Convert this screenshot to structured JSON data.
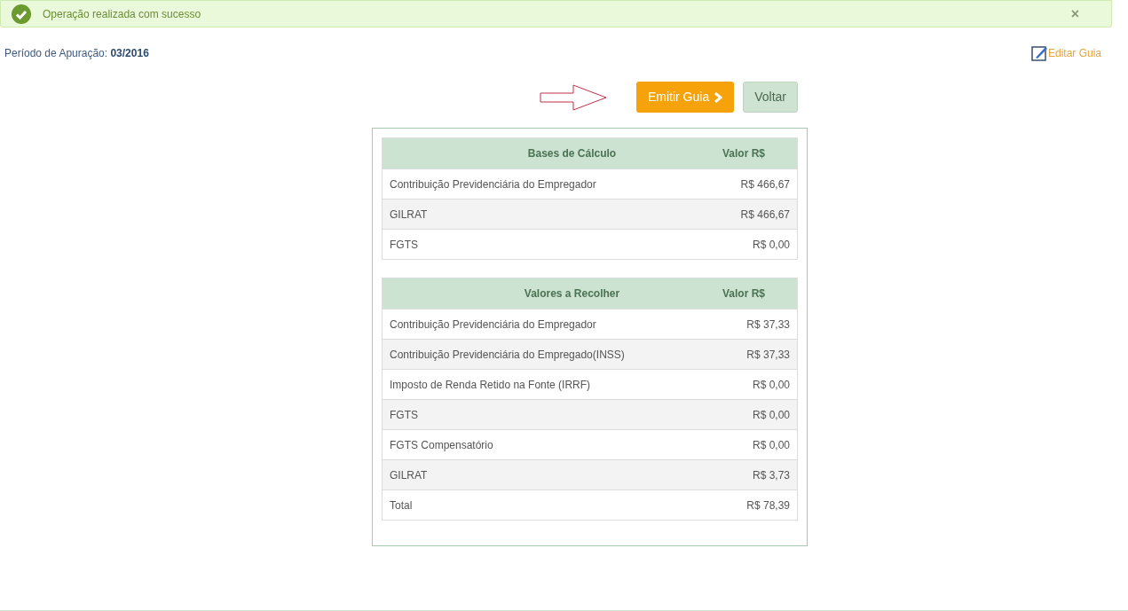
{
  "alert": {
    "message": "Operação realizada com sucesso",
    "close": "×"
  },
  "period": {
    "label": "Período de Apuração:",
    "value": "03/2016"
  },
  "edit_link": "Editar Guia",
  "buttons": {
    "emit": "Emitir Guia",
    "back": "Voltar"
  },
  "tables": [
    {
      "columns": [
        "Bases de Cálculo",
        "Valor R$"
      ],
      "rows": [
        {
          "label": "Contribuição Previdenciária do Empregador",
          "value": "R$ 466,67"
        },
        {
          "label": "GILRAT",
          "value": "R$ 466,67"
        },
        {
          "label": "FGTS",
          "value": "R$ 0,00"
        }
      ]
    },
    {
      "columns": [
        "Valores a Recolher",
        "Valor R$"
      ],
      "rows": [
        {
          "label": "Contribuição Previdenciária do Empregador",
          "value": "R$ 37,33"
        },
        {
          "label": "Contribuição Previdenciária do Empregado(INSS)",
          "value": "R$ 37,33"
        },
        {
          "label": "Imposto de Renda Retido na Fonte (IRRF)",
          "value": "R$ 0,00"
        },
        {
          "label": "FGTS",
          "value": "R$ 0,00"
        },
        {
          "label": "FGTS Compensatório",
          "value": "R$ 0,00"
        },
        {
          "label": "GILRAT",
          "value": "R$ 3,73"
        },
        {
          "label": "Total",
          "value": "R$ 78,39"
        }
      ]
    }
  ]
}
